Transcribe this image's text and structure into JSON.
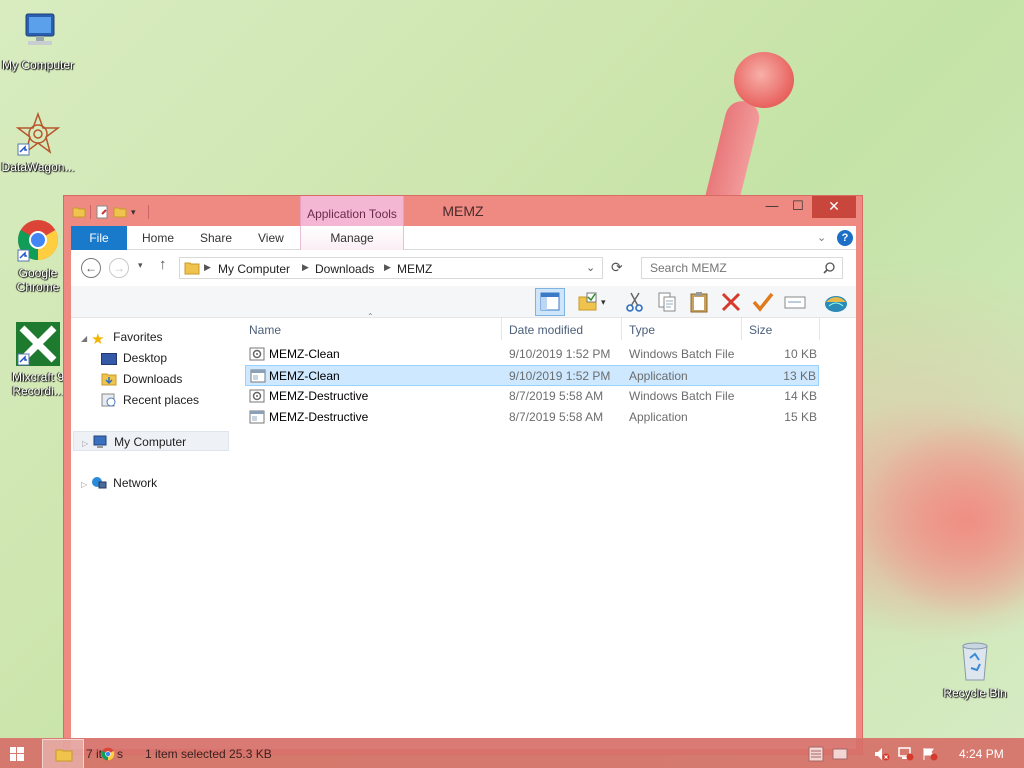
{
  "desktop": {
    "icons": [
      {
        "label": "My Computer"
      },
      {
        "label": "DataWagon..."
      },
      {
        "label": "Google Chrome"
      },
      {
        "label": "Mixcraft 9 Recordi..."
      },
      {
        "label": "Recycle Bin"
      }
    ]
  },
  "window": {
    "title": "MEMZ",
    "context_tab": "Application Tools",
    "minimize_glyph": "—",
    "maximize_glyph": "☐",
    "close_glyph": "✕",
    "ribbon_tabs": [
      "File",
      "Home",
      "Share",
      "View",
      "Manage"
    ],
    "help_glyph": "?",
    "address": {
      "crumbs": [
        "My Computer",
        "Downloads",
        "MEMZ"
      ]
    },
    "search": {
      "placeholder": "Search MEMZ"
    },
    "nav": {
      "favorites": "Favorites",
      "desktop": "Desktop",
      "downloads": "Downloads",
      "recent_places": "Recent places",
      "my_computer": "My Computer",
      "network": "Network"
    },
    "columns": {
      "name": "Name",
      "date": "Date modified",
      "type": "Type",
      "size": "Size"
    },
    "files": [
      {
        "name": "MEMZ-Clean",
        "date": "9/10/2019 1:52 PM",
        "type": "Windows Batch File",
        "size": "10 KB"
      },
      {
        "name": "MEMZ-Clean",
        "date": "9/10/2019 1:52 PM",
        "type": "Application",
        "size": "13 KB"
      },
      {
        "name": "MEMZ-Destructive",
        "date": "8/7/2019 5:58 AM",
        "type": "Windows Batch File",
        "size": "14 KB"
      },
      {
        "name": "MEMZ-Destructive",
        "date": "8/7/2019 5:58 AM",
        "type": "Application",
        "size": "15 KB"
      }
    ],
    "selected_row": 1
  },
  "taskbar": {
    "status_items": "7 it",
    "status_items_tail": "s",
    "status_selected": "1 item selected  25.3 KB",
    "clock": "4:24 PM"
  },
  "colors": {
    "window_frame": "#ef8a83",
    "accent_file_tab": "#1979ca",
    "selection": "#cde8ff",
    "context_tab": "#f4b7d3"
  }
}
